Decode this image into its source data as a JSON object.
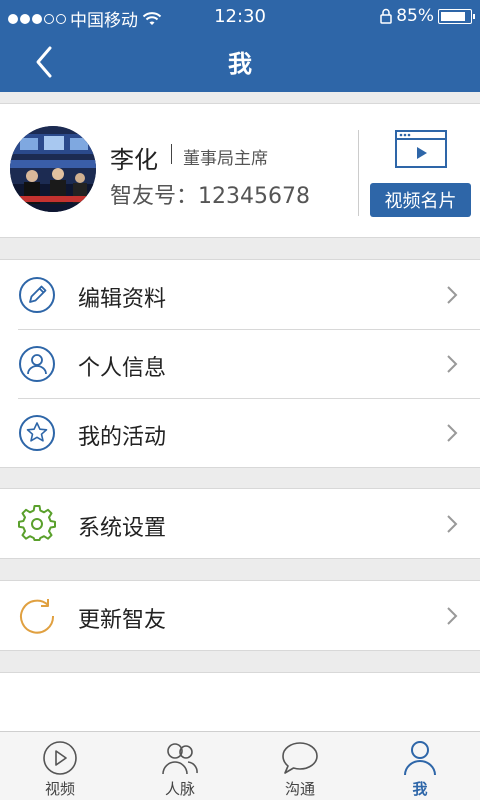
{
  "statusbar": {
    "carrier": "中国移动",
    "time": "12:30",
    "battery": "85%",
    "battery_level": 0.85,
    "signal_bars_filled": 3,
    "signal_bars_total": 5
  },
  "header": {
    "title": "我"
  },
  "profile": {
    "name": "李化",
    "role": "董事局主席",
    "id_text": "智友号：12345678",
    "video_card_label": "视频名片"
  },
  "menu": {
    "group1": [
      {
        "label": "编辑资料",
        "icon": "edit-icon"
      },
      {
        "label": "个人信息",
        "icon": "user-icon"
      },
      {
        "label": "我的活动",
        "icon": "star-icon"
      }
    ],
    "group2": [
      {
        "label": "系统设置",
        "icon": "gear-icon"
      }
    ],
    "group3": [
      {
        "label": "更新智友",
        "icon": "refresh-icon"
      }
    ]
  },
  "tabs": [
    {
      "label": "视频",
      "icon": "play-icon"
    },
    {
      "label": "人脉",
      "icon": "contacts-icon"
    },
    {
      "label": "沟通",
      "icon": "chat-icon"
    },
    {
      "label": "我",
      "icon": "person-icon"
    }
  ],
  "colors": {
    "brand": "#2e66a8",
    "settings_green": "#5aa02c",
    "refresh_orange": "#e0a040"
  }
}
